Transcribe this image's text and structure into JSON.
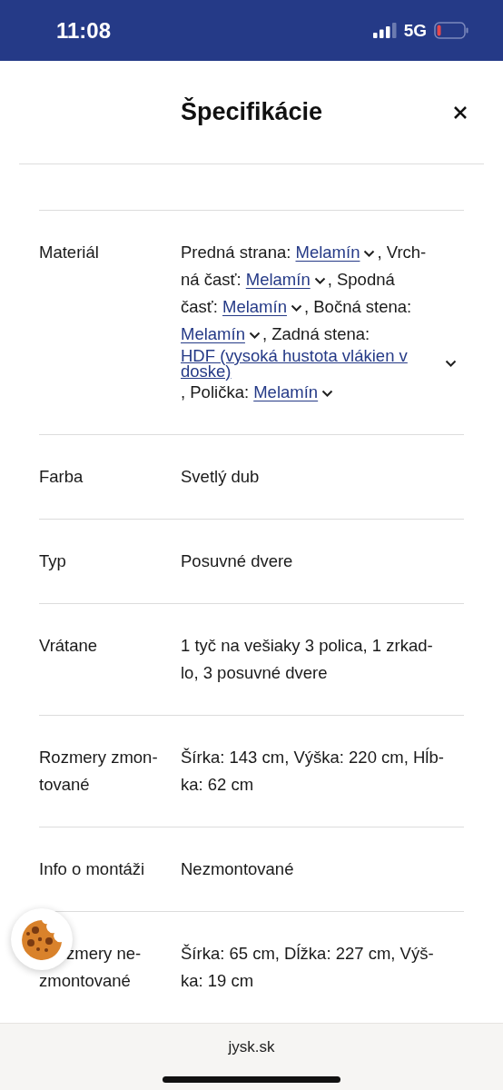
{
  "status_bar": {
    "time": "11:08",
    "network": "5G"
  },
  "header": {
    "title": "Špecifikácie"
  },
  "specs": [
    {
      "kind": "rich",
      "label_lines": [
        "Materiál"
      ],
      "segments": [
        {
          "kind": "text",
          "text": "Predná strana: "
        },
        {
          "kind": "link",
          "text": "Melamín"
        },
        {
          "kind": "text",
          "text": ", Vrch-"
        },
        {
          "kind": "break"
        },
        {
          "kind": "text",
          "text": "ná časť: "
        },
        {
          "kind": "link",
          "text": "Melamín"
        },
        {
          "kind": "text",
          "text": ", Spodná"
        },
        {
          "kind": "break"
        },
        {
          "kind": "text",
          "text": "časť: "
        },
        {
          "kind": "link",
          "text": "Melamín"
        },
        {
          "kind": "text",
          "text": ", Bočná stena:"
        },
        {
          "kind": "break"
        },
        {
          "kind": "link",
          "text": "Melamín"
        },
        {
          "kind": "text",
          "text": ", Zadná stena:"
        },
        {
          "kind": "break"
        },
        {
          "kind": "block_link",
          "text": "HDF (vysoká hustota vlákien v doske)"
        },
        {
          "kind": "text",
          "text": ", Polička: "
        },
        {
          "kind": "link",
          "text": "Melamín"
        }
      ]
    },
    {
      "kind": "plain",
      "label_lines": [
        "Farba"
      ],
      "value_lines": [
        "Svetlý dub"
      ]
    },
    {
      "kind": "plain",
      "label_lines": [
        "Typ"
      ],
      "value_lines": [
        "Posuvné dvere"
      ]
    },
    {
      "kind": "plain",
      "label_lines": [
        "Vrátane"
      ],
      "value_lines": [
        "1 tyč na vešiaky 3 polica, 1 zrkad-",
        "lo, 3 posuvné dvere"
      ]
    },
    {
      "kind": "plain",
      "label_lines": [
        "Rozmery zmon-",
        "tované"
      ],
      "value_lines": [
        "Šírka: 143 cm, Výška: 220 cm, Hĺb-",
        "ka: 62 cm"
      ]
    },
    {
      "kind": "plain",
      "label_lines": [
        "Info o montáži"
      ],
      "value_lines": [
        "Nezmontované"
      ]
    },
    {
      "kind": "plain",
      "covered": true,
      "label_lines": [
        "zmery ne-",
        "zmontované"
      ],
      "value_lines": [
        "Šírka: 65 cm, Dĺžka: 227 cm, Výš-",
        "ka: 19 cm"
      ]
    }
  ],
  "browser": {
    "url": "jysk.sk"
  }
}
